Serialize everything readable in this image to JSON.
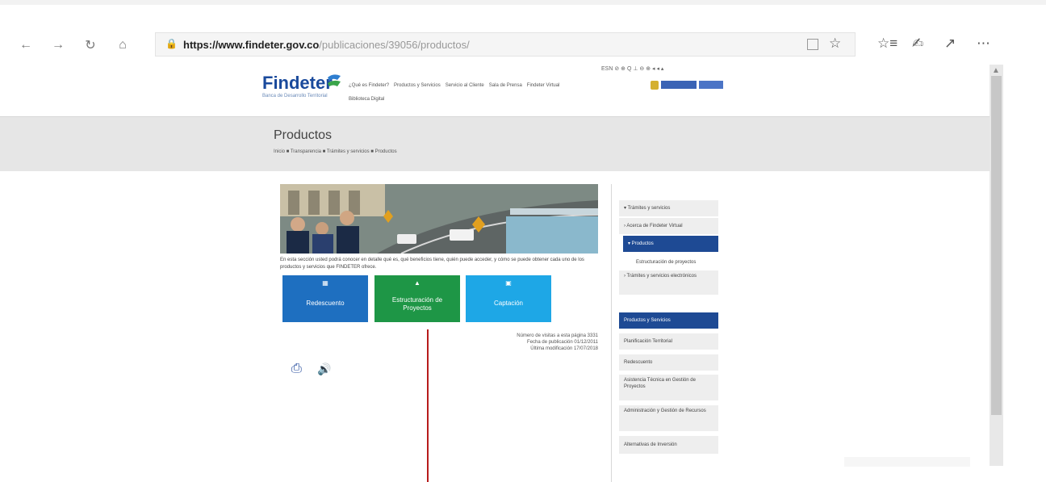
{
  "browser": {
    "url_host": "https://www.findeter.gov.co",
    "url_path": "/publicaciones/39056/productos/",
    "icons": [
      "back-icon",
      "forward-icon",
      "refresh-icon",
      "home-icon",
      "lock-icon",
      "reading-view-icon",
      "favorite-star-icon",
      "favorites-list-icon",
      "pen-icon",
      "share-icon",
      "more-icon"
    ]
  },
  "site": {
    "logo_text": "Findeter",
    "logo_sub": "Banca de Desarrollo Territorial",
    "nav": [
      "¿Qué es Findeter?",
      "Productos y Servicios",
      "Servicio al Cliente",
      "Sala de Prensa",
      "Findeter Virtual"
    ],
    "nav2": "Biblioteca Digital",
    "a11y_tools": "ESN  ⊘ ⊕ Q ⊥ ⊖ ⊕  ◂ ◂ ▴"
  },
  "titleband": {
    "title": "Productos",
    "breadcrumb": "Inicio ■ Transparencia ■ Trámites y servicios ■ Productos"
  },
  "content": {
    "intro": "En esta sección usted podrá conocer en detalle qué es, qué beneficios tiene, quién puede acceder, y cómo se puede obtener cada uno de los productos y servicios que FINDETER ofrece.",
    "tiles": [
      {
        "label": "Redescuento",
        "icon": "money-icon"
      },
      {
        "label": "Estructuración de Proyectos",
        "icon": "structure-icon"
      },
      {
        "label": "Captación",
        "icon": "savings-icon"
      }
    ],
    "meta": [
      "Número de visitas a esta página 3331",
      "Fecha de publicación 01/12/2011",
      "Última modificación 17/07/2018"
    ]
  },
  "sidebar": {
    "items": [
      {
        "label": "▾ Trámites y servicios",
        "style": "grey"
      },
      {
        "label": "› Acerca de Findeter Virtual",
        "style": "grey"
      },
      {
        "label": "▾ Productos",
        "style": "blue"
      },
      {
        "label": "Estructuración de proyectos",
        "style": "plain"
      },
      {
        "label": "› Trámites y servicios electrónicos",
        "style": "grey"
      },
      {
        "label": "Productos y Servicios",
        "style": "blue"
      },
      {
        "label": "Planificación Territorial",
        "style": "grey"
      },
      {
        "label": "Redescuento",
        "style": "grey"
      },
      {
        "label": "Asistencia Técnica en Gestión de Proyectos",
        "style": "grey"
      },
      {
        "label": "Administración y Gestión de Recursos",
        "style": "grey"
      },
      {
        "label": "Alternativas de Inversión",
        "style": "grey"
      }
    ]
  },
  "colors": {
    "brand_blue": "#1a4a9c",
    "tile_blue": "#1e6fc0",
    "tile_green": "#1e9646",
    "tile_cyan": "#1ea7e6",
    "annotation_red": "#b71c1c"
  }
}
